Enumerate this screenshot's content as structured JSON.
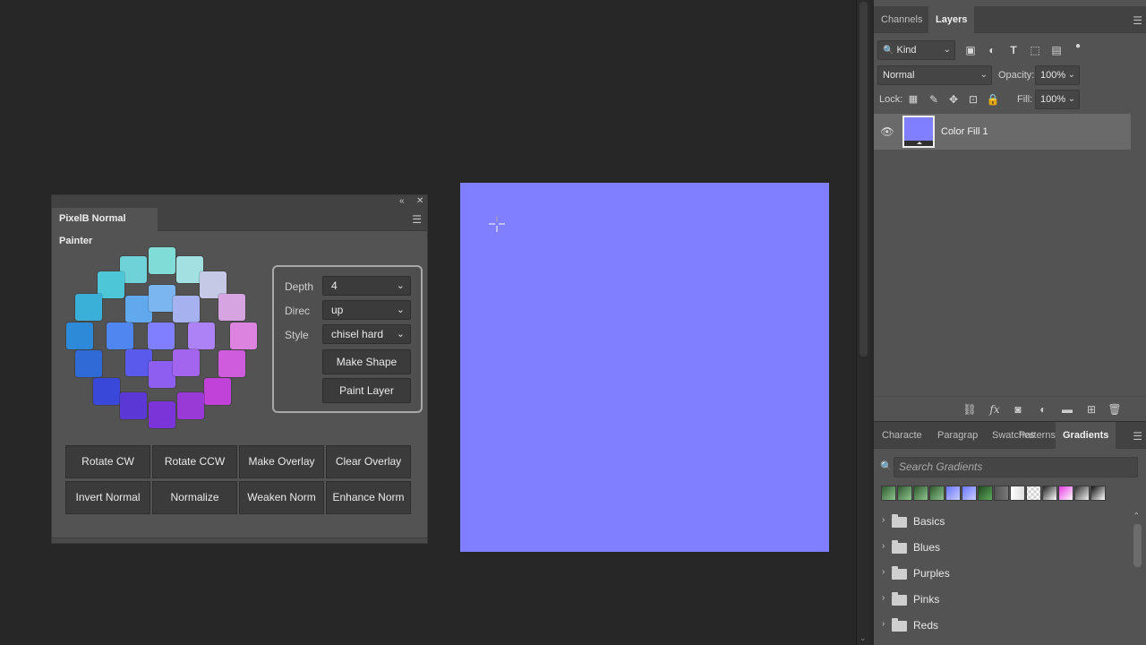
{
  "canvas": {
    "fill_color": "#7f7fff"
  },
  "plugin_panel": {
    "tab_title": "PixelB Normal Painter",
    "swatches": [
      {
        "color": "#7fdcd6"
      },
      {
        "color": "#6fd2d8"
      },
      {
        "color": "#a2e0e2"
      },
      {
        "color": "#4dc6d8"
      },
      {
        "color": "#c5c9e6"
      },
      {
        "color": "#3ab0d8"
      },
      {
        "color": "#62a8ec"
      },
      {
        "color": "#7bb6f0"
      },
      {
        "color": "#a6b2ef"
      },
      {
        "color": "#d7a4e2"
      },
      {
        "color": "#2c8ad8"
      },
      {
        "color": "#4f86ef"
      },
      {
        "color": "#7f7fff"
      },
      {
        "color": "#ad82f7"
      },
      {
        "color": "#dc82df"
      },
      {
        "color": "#2f6ad6"
      },
      {
        "color": "#5a5bed"
      },
      {
        "color": "#8e5ef0"
      },
      {
        "color": "#a364ee"
      },
      {
        "color": "#cf5cdc"
      },
      {
        "color": "#3a48da"
      },
      {
        "color": "#c042d8"
      },
      {
        "color": "#5b38d6"
      },
      {
        "color": "#7a34d8"
      },
      {
        "color": "#9a3ad6"
      }
    ],
    "depth_label": "Depth",
    "depth_value": "4",
    "direc_label": "Direc",
    "direc_value": "up",
    "style_label": "Style",
    "style_value": "chisel hard",
    "make_shape_label": "Make Shape",
    "paint_layer_label": "Paint Layer",
    "grid_buttons": [
      "Rotate CW",
      "Rotate CCW",
      "Make Overlay",
      "Clear Overlay",
      "Invert Normal",
      "Normalize",
      "Weaken Norm",
      "Enhance Norm"
    ]
  },
  "layers_panel": {
    "tabs": [
      "Channels",
      "Layers"
    ],
    "active_tab": "Layers",
    "filter_kind": "Kind",
    "blend_mode": "Normal",
    "opacity_label": "Opacity:",
    "opacity_value": "100%",
    "lock_label": "Lock:",
    "fill_label": "Fill:",
    "fill_value": "100%",
    "layer_name": "Color Fill 1"
  },
  "gradients_panel": {
    "tabs": [
      "Characte",
      "Paragrap",
      "Swatches",
      "Patterns",
      "Gradients"
    ],
    "active_tab": "Gradients",
    "search_placeholder": "Search Gradients",
    "presets": [
      {
        "color": "linear-gradient(135deg,#2f5a2f,#8ec48e)"
      },
      {
        "color": "linear-gradient(135deg,#2f5a2f,#8ec48e)"
      },
      {
        "color": "linear-gradient(135deg,#2f5a2f,#8ec48e)"
      },
      {
        "color": "linear-gradient(135deg,#2f5a2f,#8ec48e)"
      },
      {
        "color": "linear-gradient(135deg,#6a76ff,#c8ccff)"
      },
      {
        "color": "linear-gradient(135deg,#6a76ff,#c8ccff)"
      },
      {
        "color": "linear-gradient(135deg,#1f4a1f,#5fa85f)"
      },
      {
        "color": "linear-gradient(90deg,#555,#777)"
      },
      {
        "color": "linear-gradient(90deg,#ffffff,#dddddd)"
      },
      {
        "color": "repeating-conic-gradient(#cccccc 0% 25%, #ffffff 0% 50%) 50% / 6px 6px"
      },
      {
        "color": "linear-gradient(135deg,#222,#ffffff)"
      },
      {
        "color": "linear-gradient(135deg,#e53be0,#ffffff)"
      },
      {
        "color": "linear-gradient(135deg,#333,#eeeeee)"
      },
      {
        "color": "linear-gradient(135deg,#111,#ffffff)"
      }
    ],
    "folders": [
      "Basics",
      "Blues",
      "Purples",
      "Pinks",
      "Reds"
    ]
  }
}
